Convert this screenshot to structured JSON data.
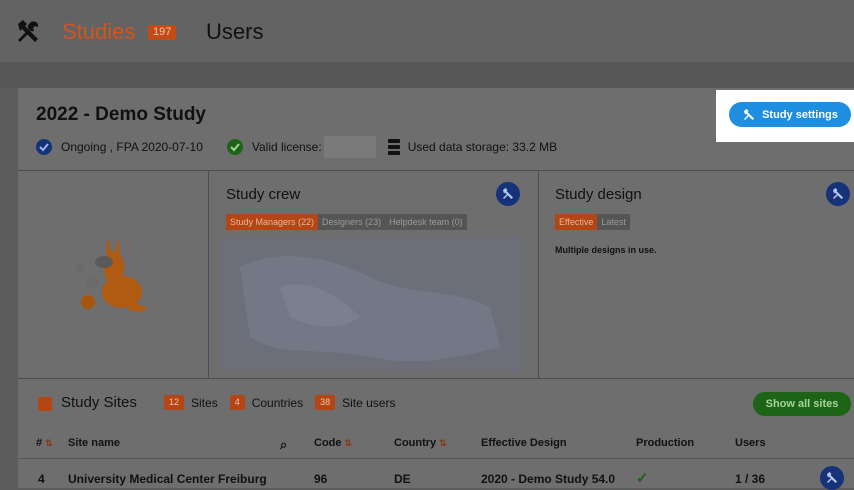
{
  "topbar": {
    "tool_icon": "tools-icon",
    "studies_label": "Studies",
    "studies_count": "197",
    "users_label": "Users"
  },
  "study": {
    "title": "2022 - Demo Study",
    "status": "Ongoing , FPA 2020-07-10",
    "license_label": "Valid license:",
    "storage": "Used data storage: 33.2 MB",
    "settings_button": "Study settings"
  },
  "crew": {
    "title": "Study crew",
    "tabs": [
      "Study Managers (22)",
      "Designers (23)",
      "Helpdesk team (0)"
    ]
  },
  "design": {
    "title": "Study design",
    "tabs": [
      "Effective",
      "Latest"
    ],
    "note": "Multiple designs in use."
  },
  "sites": {
    "title": "Study Sites",
    "counts": [
      {
        "value": "12",
        "label": "Sites"
      },
      {
        "value": "4",
        "label": "Countries"
      },
      {
        "value": "38",
        "label": "Site users"
      }
    ],
    "show_all": "Show all sites",
    "columns": [
      "#",
      "Site name",
      "Code",
      "Country",
      "Effective Design",
      "Production",
      "Users"
    ],
    "rows": [
      {
        "num": "4",
        "name": "University Medical Center Freiburg",
        "code": "96",
        "country": "DE",
        "design": "2020 - Demo Study 54.0",
        "production": "✓",
        "users": "1 / 36"
      }
    ]
  },
  "colors": {
    "accent_orange": "#d4541e",
    "button_blue": "#1e8fe0",
    "success_green": "#1d6416",
    "icon_navy": "#16337a"
  }
}
